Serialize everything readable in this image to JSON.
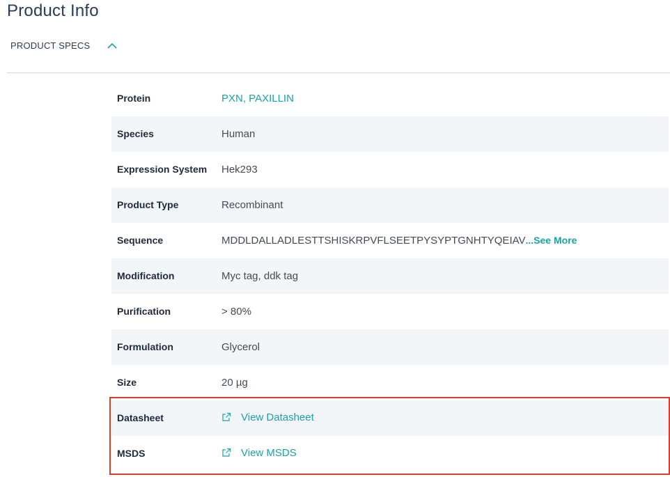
{
  "header": {
    "title": "Product Info"
  },
  "section": {
    "toggle_label": "PRODUCT SPECS",
    "expanded": true
  },
  "specs": [
    {
      "key": "Protein",
      "value": "PXN, PAXILLIN",
      "is_link": true
    },
    {
      "key": "Species",
      "value": "Human"
    },
    {
      "key": "Expression System",
      "value": "Hek293"
    },
    {
      "key": "Product Type",
      "value": "Recombinant"
    },
    {
      "key": "Sequence",
      "value": "MDDLDALLADLESTTSHISKRPVFLSEETPYSYPTGNHTYQEIAV",
      "more_label": "...See More"
    },
    {
      "key": "Modification",
      "value": "Myc tag, ddk tag"
    },
    {
      "key": "Purification",
      "value": "> 80%"
    },
    {
      "key": "Formulation",
      "value": "Glycerol"
    },
    {
      "key": "Size",
      "value": "20 µg"
    },
    {
      "key": "Datasheet",
      "value": "View Datasheet",
      "icon": "external-link-icon"
    },
    {
      "key": "MSDS",
      "value": "View MSDS",
      "icon": "external-link-icon"
    }
  ],
  "colors": {
    "accent": "#1aa3a8",
    "title": "#2b3b55",
    "highlight": "#e03a2e",
    "row_shade": "#f3f6f9"
  }
}
